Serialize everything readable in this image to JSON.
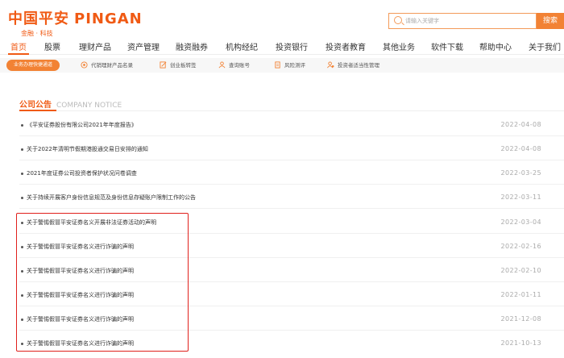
{
  "brand": {
    "logo_cn": "中国平安",
    "logo_en": "PINGAN",
    "tagline": "金融 · 科技"
  },
  "search": {
    "placeholder": "请输入关键字",
    "button_label": "搜索"
  },
  "nav": {
    "active_index": 0,
    "items": [
      "首页",
      "股票",
      "理财产品",
      "资产管理",
      "融资融券",
      "机构经纪",
      "投资银行",
      "投资者教育",
      "其他业务",
      "软件下载",
      "帮助中心",
      "关于我们"
    ]
  },
  "toolbar": {
    "pill_label": "业务办理快捷通道",
    "items": [
      {
        "label": "代销理财产品名录",
        "icon": "product-list-icon"
      },
      {
        "label": "创业板转签",
        "icon": "edit-icon"
      },
      {
        "label": "查询账号",
        "icon": "user-search-icon"
      },
      {
        "label": "风险测评",
        "icon": "document-icon"
      },
      {
        "label": "投资者适当性管理",
        "icon": "user-manage-icon"
      }
    ]
  },
  "section": {
    "title_cn": "公司公告",
    "title_en": "COMPANY NOTICE"
  },
  "notices": [
    {
      "title": "《平安证券股份有限公司2021年年度报告》",
      "date": "2022-04-08"
    },
    {
      "title": "关于2022年清明节假期港股通交易日安排的通知",
      "date": "2022-04-08"
    },
    {
      "title": "2021年度证券公司投资者保护状况问卷调查",
      "date": "2022-03-25"
    },
    {
      "title": "关于持续开展客户身份信息规范及身份信息存疑账户限制工作的公告",
      "date": "2022-03-11"
    },
    {
      "title": "关于警惕假冒平安证券名义开展非法证券活动的声明",
      "date": "2022-03-04"
    },
    {
      "title": "关于警惕假冒平安证券名义进行诈骗的声明",
      "date": "2022-02-16"
    },
    {
      "title": "关于警惕假冒平安证券名义进行诈骗的声明",
      "date": "2022-02-10"
    },
    {
      "title": "关于警惕假冒平安证券名义进行诈骗的声明",
      "date": "2022-01-11"
    },
    {
      "title": "关于警惕假冒平安证券名义进行诈骗的声明",
      "date": "2021-12-08"
    },
    {
      "title": "关于警惕假冒平安证券名义进行诈骗的声明",
      "date": "2021-10-13"
    }
  ],
  "colors": {
    "brand_orange": "#f05a14",
    "highlight_red": "#e0201c"
  }
}
